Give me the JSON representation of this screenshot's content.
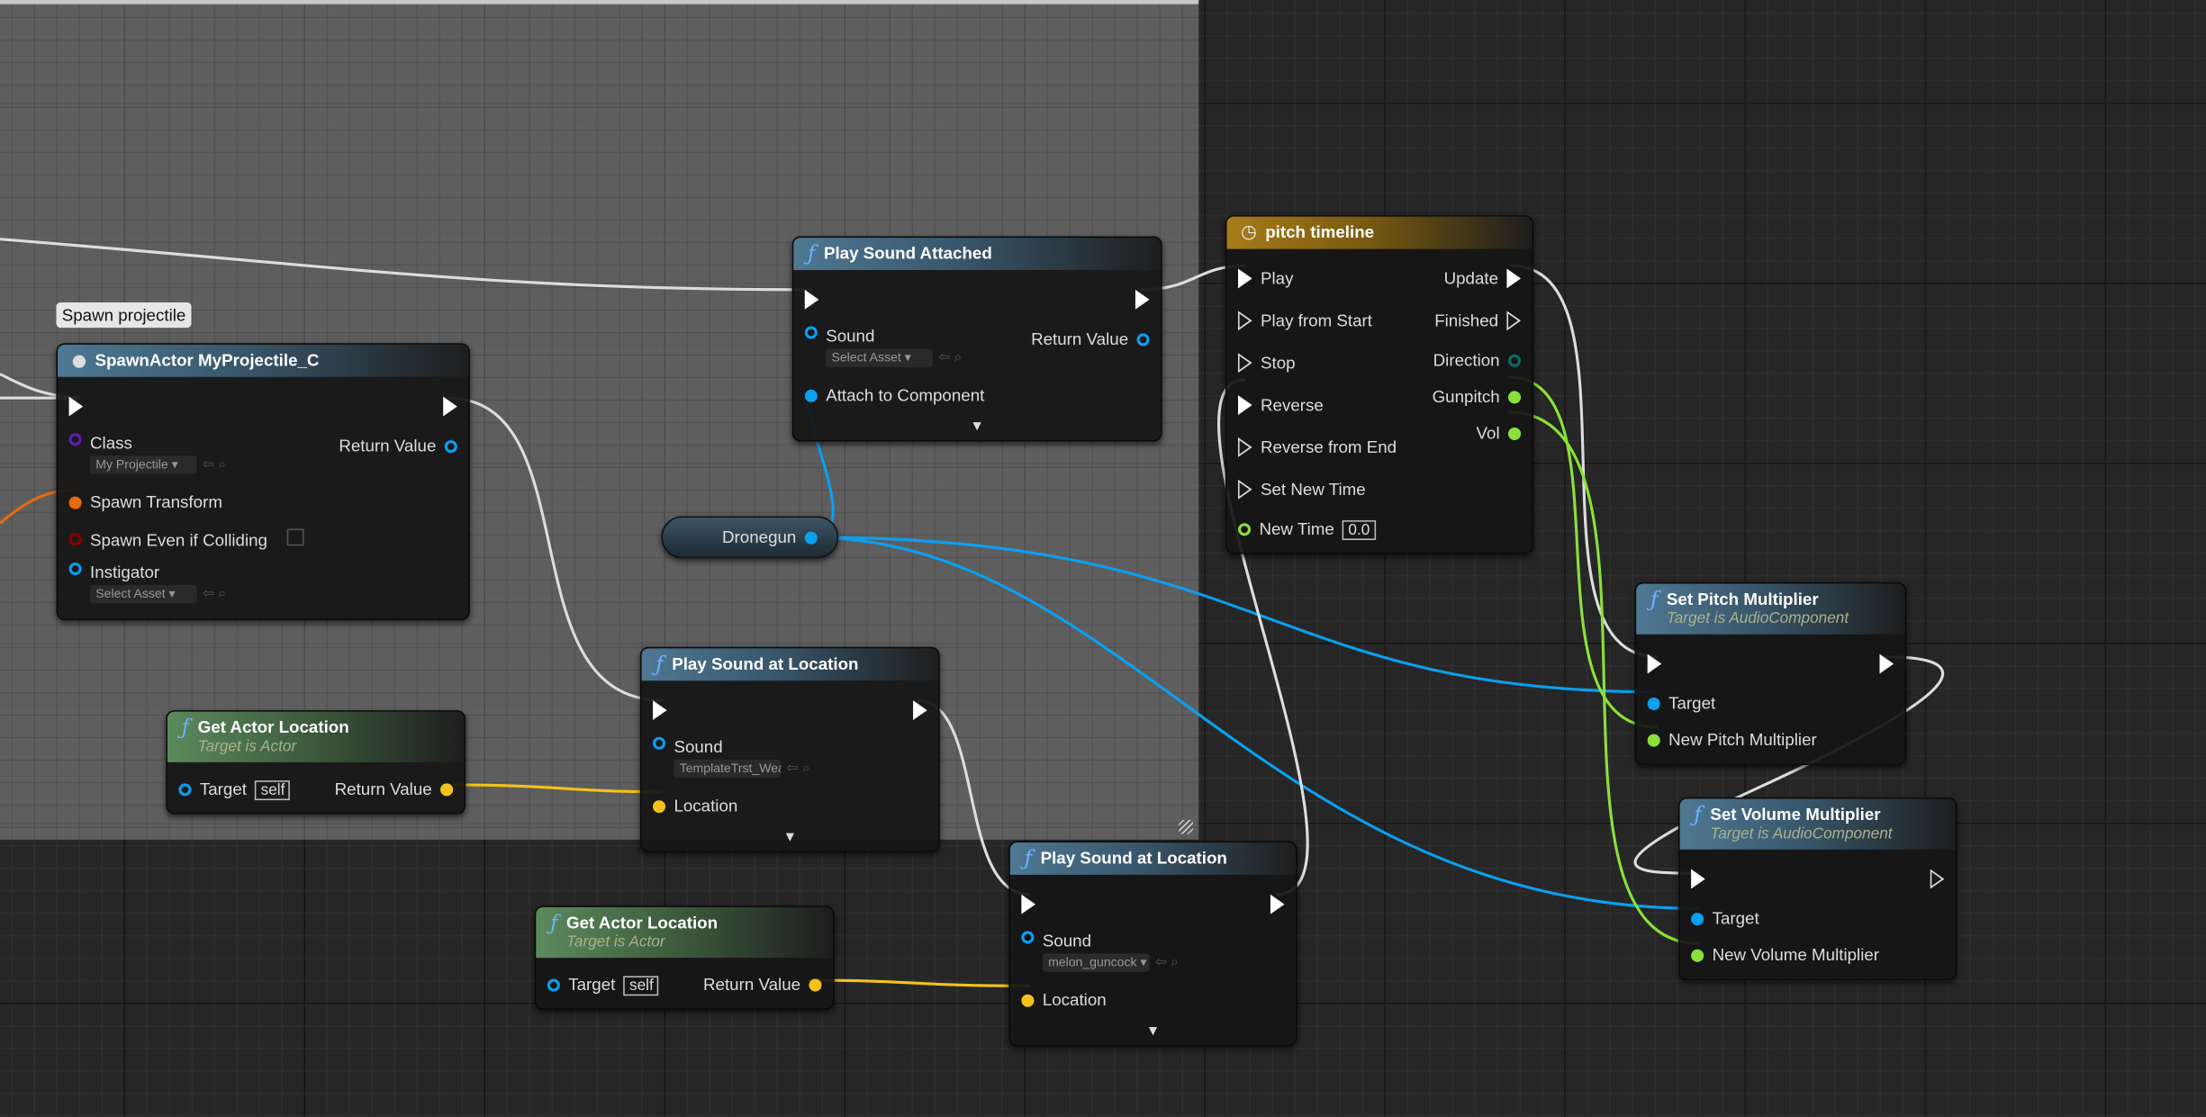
{
  "colors": {
    "exec": "#ffffff",
    "object": "#0aa0f0",
    "class": "#5a1fb0",
    "struct": "#e8690e",
    "bool": "#8a0000",
    "vector": "#f5c21a",
    "float": "#8be03a",
    "enum": "#0b6a66"
  },
  "comment_bubble": "Spawn projectile",
  "variable": {
    "name": "Dronegun",
    "type": "object"
  },
  "nodes": [
    {
      "id": "spawn",
      "style": "spawn",
      "icon": "ball-icon",
      "title": "SpawnActor MyProjectile_C",
      "subtitle": "",
      "left": [
        {
          "type": "exec",
          "filled": true
        },
        {
          "label": "Class",
          "type": "class",
          "asset": "My Projectile"
        },
        {
          "label": "Spawn Transform",
          "type": "struct",
          "filled": true
        },
        {
          "label": "Spawn Even if Colliding",
          "type": "bool",
          "checkbox": true
        },
        {
          "label": "Instigator",
          "type": "object",
          "asset": "Select Asset"
        }
      ],
      "right": [
        {
          "type": "exec",
          "filled": true
        },
        {
          "label": "Return Value",
          "type": "object"
        }
      ]
    },
    {
      "id": "psa",
      "style": "fn",
      "icon": "function-icon",
      "title": "Play Sound Attached",
      "subtitle": "",
      "expand": true,
      "left": [
        {
          "type": "exec",
          "filled": true
        },
        {
          "label": "Sound",
          "type": "object",
          "asset": "Select Asset"
        },
        {
          "label": "Attach to Component",
          "type": "object",
          "filled": true
        }
      ],
      "right": [
        {
          "type": "exec",
          "filled": true
        },
        {
          "label": "Return Value",
          "type": "object"
        }
      ]
    },
    {
      "id": "timeline",
      "style": "tl",
      "icon": "clock-icon",
      "title": "pitch timeline",
      "subtitle": "",
      "left": [
        {
          "label": "Play",
          "type": "exec",
          "filled": true
        },
        {
          "label": "Play from Start",
          "type": "exec"
        },
        {
          "label": "Stop",
          "type": "exec"
        },
        {
          "label": "Reverse",
          "type": "exec",
          "filled": true
        },
        {
          "label": "Reverse from End",
          "type": "exec"
        },
        {
          "label": "Set New Time",
          "type": "exec"
        },
        {
          "label": "New Time",
          "type": "float",
          "value": "0.0"
        }
      ],
      "right": [
        {
          "label": "Update",
          "type": "exec",
          "filled": true
        },
        {
          "label": "Finished",
          "type": "exec"
        },
        {
          "label": "Direction",
          "type": "enum"
        },
        {
          "label": "Gunpitch",
          "type": "float",
          "filled": true
        },
        {
          "label": "Vol",
          "type": "float",
          "filled": true
        }
      ]
    },
    {
      "id": "psl1",
      "style": "fn",
      "icon": "function-icon",
      "title": "Play Sound at Location",
      "subtitle": "",
      "expand": true,
      "left": [
        {
          "type": "exec",
          "filled": true
        },
        {
          "label": "Sound",
          "type": "object",
          "asset": "TemplateTrst_Wea"
        },
        {
          "label": "Location",
          "type": "vector",
          "filled": true
        }
      ],
      "right": [
        {
          "type": "exec",
          "filled": true
        }
      ]
    },
    {
      "id": "gal1",
      "style": "pure",
      "icon": "function-icon",
      "title": "Get Actor Location",
      "subtitle": "Target is Actor",
      "left": [
        {
          "label": "Target",
          "type": "object",
          "value": "self"
        }
      ],
      "right": [
        {
          "label": "Return Value",
          "type": "vector",
          "filled": true
        }
      ]
    },
    {
      "id": "psl2",
      "style": "fn",
      "icon": "function-icon",
      "title": "Play Sound at Location",
      "subtitle": "",
      "expand": true,
      "left": [
        {
          "type": "exec",
          "filled": true
        },
        {
          "label": "Sound",
          "type": "object",
          "asset": "melon_guncock"
        },
        {
          "label": "Location",
          "type": "vector",
          "filled": true
        }
      ],
      "right": [
        {
          "type": "exec",
          "filled": true
        }
      ]
    },
    {
      "id": "gal2",
      "style": "pure",
      "icon": "function-icon",
      "title": "Get Actor Location",
      "subtitle": "Target is Actor",
      "left": [
        {
          "label": "Target",
          "type": "object",
          "value": "self"
        }
      ],
      "right": [
        {
          "label": "Return Value",
          "type": "vector",
          "filled": true
        }
      ]
    },
    {
      "id": "spm",
      "style": "fn",
      "icon": "function-icon",
      "title": "Set Pitch Multiplier",
      "subtitle": "Target is AudioComponent",
      "left": [
        {
          "type": "exec",
          "filled": true
        },
        {
          "label": "Target",
          "type": "object",
          "filled": true
        },
        {
          "label": "New Pitch Multiplier",
          "type": "float",
          "filled": true
        }
      ],
      "right": [
        {
          "type": "exec",
          "filled": true
        }
      ]
    },
    {
      "id": "svm",
      "style": "fn",
      "icon": "function-icon",
      "title": "Set Volume Multiplier",
      "subtitle": "Target is AudioComponent",
      "left": [
        {
          "type": "exec",
          "filled": true
        },
        {
          "label": "Target",
          "type": "object",
          "filled": true
        },
        {
          "label": "New Volume Multiplier",
          "type": "float",
          "filled": true
        }
      ],
      "right": [
        {
          "type": "exec"
        }
      ]
    }
  ]
}
